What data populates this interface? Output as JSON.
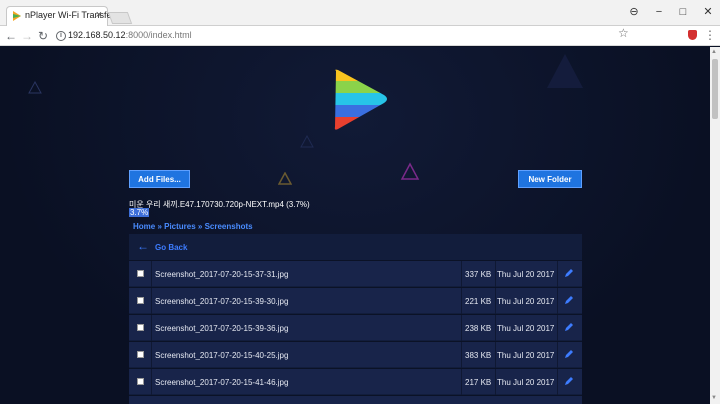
{
  "browser": {
    "tab_title": "nPlayer Wi-Fi Transfer",
    "tab_close": "×",
    "url_host": "192.168.50.12",
    "url_rest": ":8000/index.html",
    "win_controls": [
      "⊖",
      "−",
      "□",
      "✕"
    ]
  },
  "page": {
    "add_files_label": "Add Files...",
    "new_folder_label": "New Folder",
    "upload_filename": "미운 우리 새끼.E47.170730.720p-NEXT.mp4 (3.7%)",
    "upload_percent": "3.7%",
    "breadcrumb": "Home » Pictures » Screenshots",
    "go_back_label": "Go Back",
    "files": [
      {
        "name": "Screenshot_2017-07-20-15-37-31.jpg",
        "size": "337 KB",
        "date": "Thu Jul 20 2017"
      },
      {
        "name": "Screenshot_2017-07-20-15-39-30.jpg",
        "size": "221 KB",
        "date": "Thu Jul 20 2017"
      },
      {
        "name": "Screenshot_2017-07-20-15-39-36.jpg",
        "size": "238 KB",
        "date": "Thu Jul 20 2017"
      },
      {
        "name": "Screenshot_2017-07-20-15-40-25.jpg",
        "size": "383 KB",
        "date": "Thu Jul 20 2017"
      },
      {
        "name": "Screenshot_2017-07-20-15-41-46.jpg",
        "size": "217 KB",
        "date": "Thu Jul 20 2017"
      }
    ]
  },
  "colors": {
    "accent": "#1f74e0",
    "link": "#4a8cff",
    "background": "#0b1226"
  }
}
